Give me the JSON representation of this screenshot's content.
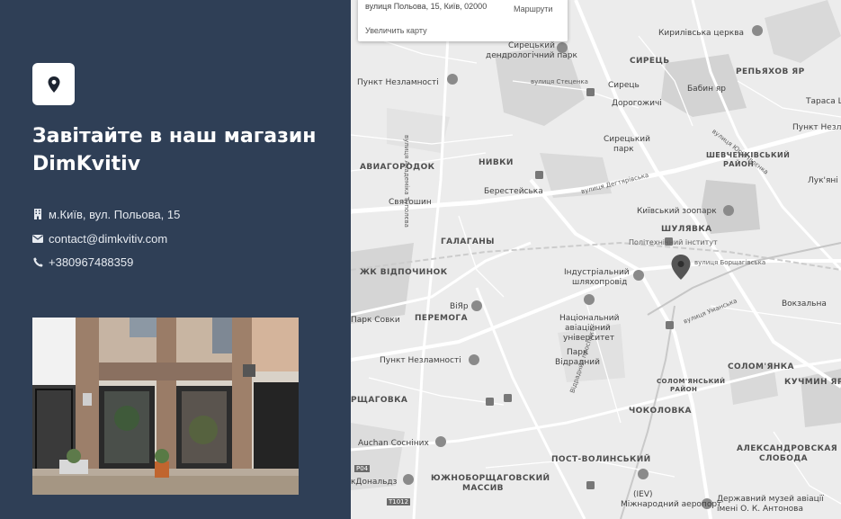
{
  "left_panel": {
    "heading_line1": "Завітайте в наш магазин",
    "heading_line2": "DimKvitiv",
    "address": "м.Київ, вул. Польова, 15",
    "email": "contact@dimkvitiv.com",
    "phone": "+380967488359"
  },
  "map": {
    "info_card": {
      "address": "вулиця Польова, 15, Київ, 02000",
      "routes_label": "Маршрути",
      "enlarge_label": "Увеличить карту"
    },
    "labels": {
      "syretskyi_park_1": "Сирецький",
      "syretskyi_park_2": "дендрологічний парк",
      "kyrylivska": "Кирилівська церква",
      "syrets": "СИРЕЦЬ",
      "repiakhov_1": "РЕПЬЯХОВ ЯР",
      "babyn_yar": "Бабин яр",
      "punkt_top": "Пункт Незламності",
      "st_stetsenka": "вулиця Стеценка",
      "syrets_st": "Сирець",
      "dorohozhychi": "Дорогожичі",
      "tarasa": "Тараса Ш",
      "punkt_right": "Пункт Незламні",
      "akad_tupoleva": "вулиця Академіка Туполєва",
      "syretskyi_park2_1": "Сирецький",
      "syretskyi_park2_2": "парк",
      "shevchenkivskyi_1": "ШЕВЧЕНКІВСЬКИЙ",
      "shevchenkivskyi_2": "РАЙОН",
      "aviahorodok": "АВИАГОРОДОК",
      "nyvky": "НИВКИ",
      "berestejska": "Берестейська",
      "degtiarivska": "вулиця Дегтярівська",
      "luk_ianivka": "Лук'яні",
      "yuria_illienka": "вулиця Юрія Іллєнка",
      "sviatoshyn": "Святошин",
      "zoo": "Київський зоопарк",
      "shuliavka": "ШУЛЯВКА",
      "galahany": "ГАЛАГАНЫ",
      "kpi": "Політехнічний інститут",
      "borshchahivska": "вулиця Борщагівська",
      "vidpochynok": "ЖК ВІДПОЧИНОК",
      "industrial_1": "Індустріальний",
      "industrial_2": "шляхопровід",
      "perehoda_park": "Парк Совки",
      "viyar": "ВіЯр",
      "peremoha": "ПЕРЕМОГА",
      "nau_1": "Національний",
      "nau_2": "авіаційний",
      "nau_3": "університет",
      "umanska": "вулиця Уманська",
      "vokzalna": "Вокзальна",
      "vidradnyi_1": "Парк",
      "vidradnyi_2": "Відрадний",
      "punkt_mid": "Пункт Незламності",
      "solomianskyi_1": "СОЛОМ'ЯНСЬКИЙ",
      "solomianskyi_2": "РАЙОН",
      "solomianka": "СОЛОМ'ЯНКА",
      "kuchmin_yar": "КУЧМИН ЯР",
      "borshchahivka": "РЩАГОВКА",
      "vidradnyi_prosp": "Відрадний проспект",
      "chokolivka": "ЧОКОЛОВКА",
      "auchan": "Auchan Сосніних",
      "oleksandrivska_1": "АЛЕКСАНДРОВСКАЯ",
      "oleksandrivska_2": "СЛОБОДА",
      "post_volynskyi": "ПОСТ-ВОЛИНСЬКИЙ",
      "p04": "P04",
      "mcdonalds": "кДональдз",
      "yuzhnoborshch_1": "ЮЖНОБОРЩАГОВСКИЙ",
      "yuzhnoborshch_2": "МАССИВ",
      "iev": "(IEV)",
      "airport": "Міжнародний аеропорт",
      "aviation_museum_1": "Державний музей авіації",
      "aviation_museum_2": "імені О. К. Антонова",
      "t1012": "T1012"
    }
  },
  "colors": {
    "panel_bg": "#2f3f56",
    "map_bg": "#eeeeee",
    "marker": "#555555"
  }
}
